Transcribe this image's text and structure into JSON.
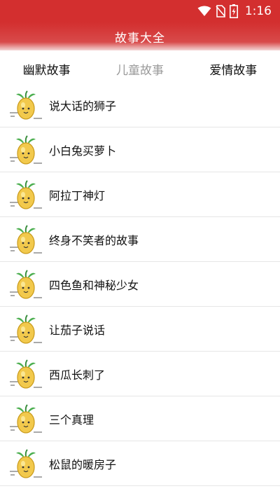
{
  "status_bar": {
    "time": "1:16",
    "icons": [
      "wifi-icon",
      "no-sim-icon",
      "battery-charging-icon"
    ]
  },
  "app_bar": {
    "title": "故事大全"
  },
  "tabs": [
    {
      "label": "幽默故事",
      "state": "normal"
    },
    {
      "label": "儿童故事",
      "state": "inactive"
    },
    {
      "label": "爱情故事",
      "state": "normal"
    }
  ],
  "stories": [
    {
      "title": "说大话的狮子",
      "icon": "lemon-mascot-icon"
    },
    {
      "title": "小白兔买萝卜",
      "icon": "lemon-mascot-icon"
    },
    {
      "title": "阿拉丁神灯",
      "icon": "lemon-mascot-icon"
    },
    {
      "title": "终身不笑者的故事",
      "icon": "lemon-mascot-icon"
    },
    {
      "title": "四色鱼和神秘少女",
      "icon": "lemon-mascot-icon"
    },
    {
      "title": "让茄子说话",
      "icon": "lemon-mascot-icon"
    },
    {
      "title": "西瓜长刺了",
      "icon": "lemon-mascot-icon"
    },
    {
      "title": "三个真理",
      "icon": "lemon-mascot-icon"
    },
    {
      "title": "松鼠的暖房子",
      "icon": "lemon-mascot-icon"
    }
  ],
  "colors": {
    "primary": "#d32f2f",
    "inactive_tab": "#9a9a9a",
    "divider": "#e6e6e6",
    "lemon": "#f2c94c",
    "leaf": "#4caf50"
  }
}
